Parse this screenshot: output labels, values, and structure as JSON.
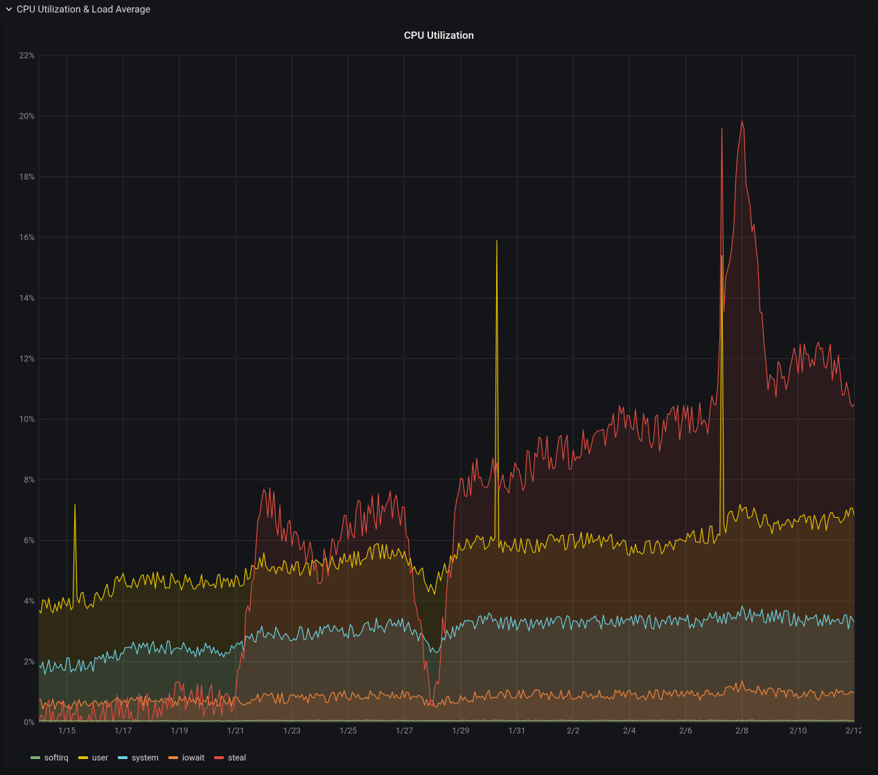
{
  "header": {
    "title": "CPU Utilization & Load Average"
  },
  "chart": {
    "title": "CPU Utilization"
  },
  "legend": {
    "items": [
      "softirq",
      "user",
      "system",
      "iowait",
      "steal"
    ]
  },
  "colors": {
    "softirq": "#7eb26d",
    "user": "#e5c100",
    "system": "#6ed0e0",
    "iowait": "#ef843c",
    "steal": "#e24d42",
    "grid": "#2c2d30",
    "axis": "#8e8e8e",
    "bg": "#141518"
  },
  "chart_data": {
    "type": "area",
    "title": "CPU Utilization",
    "xlabel": "",
    "ylabel": "",
    "ylim": [
      0,
      22
    ],
    "y_ticks": [
      0,
      2,
      4,
      6,
      8,
      10,
      12,
      14,
      16,
      18,
      20,
      22
    ],
    "y_tick_labels": [
      "0%",
      "2%",
      "4%",
      "6%",
      "8%",
      "10%",
      "12%",
      "14%",
      "16%",
      "18%",
      "20%",
      "22%"
    ],
    "x_ticks": [
      "1/15",
      "1/17",
      "1/19",
      "1/21",
      "1/23",
      "1/25",
      "1/27",
      "1/29",
      "1/31",
      "2/2",
      "2/4",
      "2/6",
      "2/8",
      "2/10",
      "2/12"
    ],
    "x_range": [
      "1/14",
      "2/12"
    ],
    "categories": [
      "1/14",
      "1/15",
      "1/16",
      "1/17",
      "1/18",
      "1/19",
      "1/20",
      "1/21",
      "1/22",
      "1/23",
      "1/24",
      "1/25",
      "1/26",
      "1/27",
      "1/28",
      "1/29",
      "1/30",
      "1/31",
      "2/1",
      "2/2",
      "2/3",
      "2/4",
      "2/5",
      "2/6",
      "2/7",
      "2/8",
      "2/9",
      "2/10",
      "2/11",
      "2/12"
    ],
    "series": [
      {
        "name": "softirq",
        "color": "#7eb26d",
        "values": [
          0.05,
          0.05,
          0.05,
          0.05,
          0.05,
          0.05,
          0.05,
          0.05,
          0.06,
          0.06,
          0.06,
          0.06,
          0.06,
          0.06,
          0.05,
          0.06,
          0.06,
          0.06,
          0.06,
          0.06,
          0.06,
          0.06,
          0.06,
          0.06,
          0.06,
          0.06,
          0.06,
          0.06,
          0.06,
          0.06
        ]
      },
      {
        "name": "user",
        "color": "#e5c100",
        "values": [
          3.8,
          4.0,
          4.0,
          4.7,
          4.7,
          4.6,
          4.6,
          4.6,
          5.3,
          5.0,
          5.2,
          5.3,
          5.6,
          5.6,
          4.4,
          5.8,
          6.0,
          5.8,
          5.9,
          6.0,
          6.0,
          5.8,
          5.8,
          6.0,
          6.2,
          7.0,
          6.5,
          6.6,
          6.6,
          6.8
        ]
      },
      {
        "name": "system",
        "color": "#6ed0e0",
        "values": [
          1.8,
          1.9,
          1.9,
          2.4,
          2.5,
          2.4,
          2.4,
          2.4,
          3.0,
          2.9,
          3.0,
          3.0,
          3.2,
          3.2,
          2.4,
          3.2,
          3.4,
          3.2,
          3.3,
          3.3,
          3.3,
          3.3,
          3.3,
          3.3,
          3.4,
          3.6,
          3.5,
          3.4,
          3.4,
          3.3
        ]
      },
      {
        "name": "iowait",
        "color": "#ef843c",
        "values": [
          0.6,
          0.6,
          0.6,
          0.7,
          0.7,
          0.7,
          0.7,
          0.7,
          0.8,
          0.8,
          0.8,
          0.9,
          0.9,
          0.9,
          0.6,
          0.8,
          0.9,
          0.9,
          0.9,
          0.9,
          0.9,
          0.9,
          0.9,
          0.9,
          0.9,
          1.2,
          1.0,
          0.9,
          0.9,
          1.0
        ]
      },
      {
        "name": "steal",
        "color": "#e24d42",
        "values": [
          0.1,
          0.1,
          0.1,
          0.3,
          0.5,
          0.8,
          0.8,
          0.6,
          7.5,
          6.0,
          5.0,
          6.5,
          7.0,
          7.0,
          0.2,
          8.0,
          8.2,
          8.0,
          9.0,
          8.8,
          9.5,
          10.0,
          9.5,
          10.0,
          10.2,
          19.6,
          11.0,
          12.0,
          12.3,
          10.5
        ]
      }
    ],
    "notable_spikes": [
      {
        "date": "1/15",
        "series": "user",
        "value": 7.2
      },
      {
        "date": "1/30",
        "series": "user",
        "value": 15.9
      },
      {
        "date": "2/7",
        "series": "steal",
        "value": 19.6
      },
      {
        "date": "2/7",
        "series": "user",
        "value": 15.4
      }
    ],
    "legend_position": "bottom-left",
    "grid": true
  }
}
